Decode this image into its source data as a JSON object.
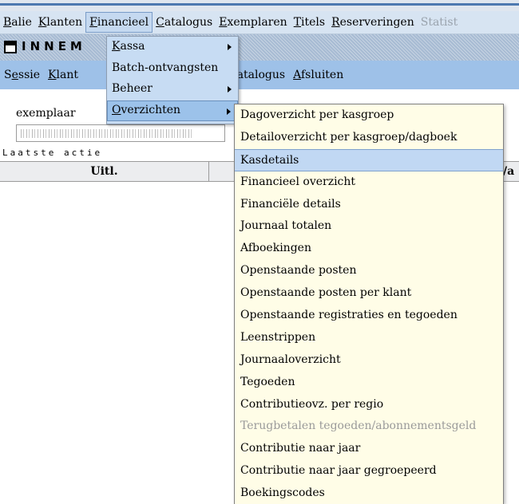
{
  "menubar": {
    "items": [
      {
        "key": "B",
        "rest": "alie"
      },
      {
        "key": "K",
        "rest": "lanten"
      },
      {
        "key": "F",
        "rest": "inancieel"
      },
      {
        "key": "C",
        "rest": "atalogus"
      },
      {
        "key": "E",
        "rest": "xemplaren"
      },
      {
        "key": "T",
        "rest": "itels"
      },
      {
        "key": "R",
        "rest": "eserveringen"
      },
      {
        "key": "",
        "rest": "Statist"
      }
    ]
  },
  "window": {
    "title": "INNEM",
    "icon": "window-icon"
  },
  "subbar": {
    "sessie": {
      "pre": "S",
      "key": "e",
      "rest": "ssie"
    },
    "klant": {
      "pre": "",
      "key": "K",
      "rest": "lant"
    },
    "catalogus": {
      "pre": "",
      "key": "C",
      "rest": "atalogus"
    },
    "afsluiten": {
      "pre": "",
      "key": "A",
      "rest": "fsluiten"
    }
  },
  "form": {
    "exemplaar_label": "exemplaar",
    "laatste_actie_label": "Laatste actie"
  },
  "grid": {
    "col_uitl": "Uitl.",
    "col_va": "/a"
  },
  "financieel_menu": {
    "kassa": {
      "key": "K",
      "rest": "assa"
    },
    "batch": "Batch-ontvangsten",
    "beheer": "Beheer",
    "overzichten": {
      "key": "O",
      "rest": "verzichten"
    }
  },
  "overzichten_menu": {
    "items": [
      "Dagoverzicht per kasgroep",
      "Detailoverzicht per kasgroep/dagboek",
      "Kasdetails",
      "Financieel overzicht",
      "Financiële details",
      "Journaal totalen",
      "Afboekingen",
      "Openstaande posten",
      "Openstaande posten per klant",
      "Openstaande registraties en tegoeden",
      "Leenstrippen",
      "Journaaloverzicht",
      "Tegoeden",
      "Contributieovz. per regio",
      "Terugbetalen tegoeden/abonnementsgeld",
      "Contributie naar jaar",
      "Contributie naar jaar gegroepeerd",
      "Boekingscodes"
    ]
  },
  "colors": {
    "menubar_bg": "#d7e4f2",
    "subbar_bg": "#9ec1e8",
    "submenu_bg": "#fffde7",
    "highlight": "#c1d8f3",
    "disabled_text": "#9a9a9a"
  }
}
